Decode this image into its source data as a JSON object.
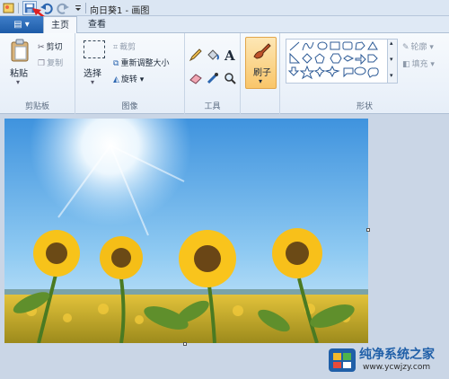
{
  "titlebar": {
    "title": "向日葵1 - 画图",
    "icons": [
      "app-icon",
      "save-icon",
      "undo-icon",
      "redo-icon",
      "customize-quick-access-icon"
    ]
  },
  "tabs": {
    "file_menu": "▤ ▾",
    "home": "主页",
    "view": "查看"
  },
  "clipboard": {
    "paste": "粘贴",
    "cut": "剪切",
    "copy": "复制",
    "label": "剪贴板"
  },
  "image": {
    "select": "选择",
    "crop": "裁剪",
    "resize": "重新调整大小",
    "rotate": "旋转",
    "label": "图像"
  },
  "tools": {
    "label": "工具",
    "items": [
      "pencil-icon",
      "fill-icon",
      "text-icon",
      "eraser-icon",
      "color-picker-icon",
      "magnifier-icon"
    ]
  },
  "brush": {
    "label": "刷子"
  },
  "shapes": {
    "outline": "轮廓",
    "fill": "填充",
    "label": "形状"
  },
  "watermark": {
    "name": "纯净系统之家",
    "url": "www.ycwjzy.com"
  },
  "colors": {
    "accent": "#1d5ba8",
    "active_tool": "#f9c66a",
    "annotation_arrow": "#e02020"
  }
}
